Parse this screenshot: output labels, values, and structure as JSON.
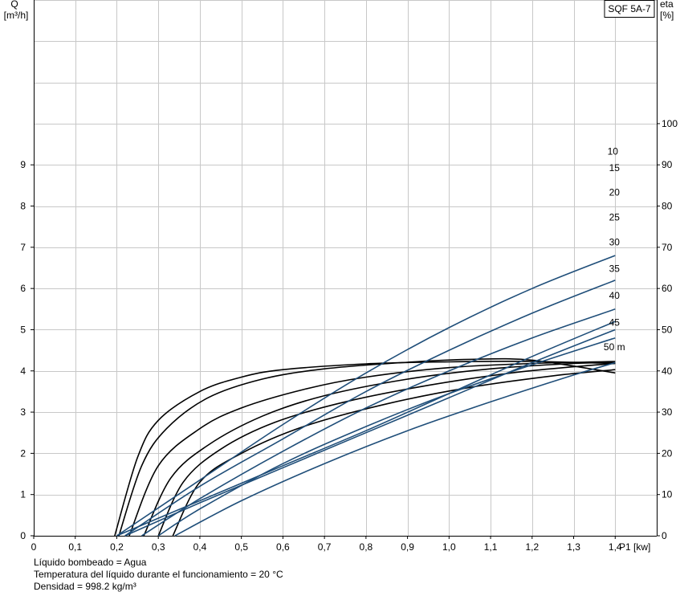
{
  "chart_data": {
    "type": "line",
    "title": "SQF 5A-7",
    "x_axis": {
      "label": "P1 [kw]",
      "min": 0,
      "max": 1.5,
      "ticks": [
        0,
        0.1,
        0.2,
        0.3,
        0.4,
        0.5,
        0.6,
        0.7,
        0.8,
        0.9,
        1.0,
        1.1,
        1.2,
        1.3,
        1.4
      ],
      "tick_labels": [
        "0",
        "0,1",
        "0,2",
        "0,3",
        "0,4",
        "0,5",
        "0,6",
        "0,7",
        "0,8",
        "0,9",
        "1,0",
        "1,1",
        "1,2",
        "1,3",
        "1,4"
      ]
    },
    "y_left": {
      "label_line1": "Q",
      "label_line2": "[m³/h]",
      "min": 0,
      "max": 13,
      "ticks": [
        0,
        1,
        2,
        3,
        4,
        5,
        6,
        7,
        8,
        9
      ],
      "tick_labels": [
        "0",
        "1",
        "2",
        "3",
        "4",
        "5",
        "6",
        "7",
        "8",
        "9"
      ]
    },
    "y_right": {
      "label_line1": "eta",
      "label_line2": "[%]",
      "min": 0,
      "max": 130,
      "ticks": [
        0,
        10,
        20,
        30,
        40,
        50,
        60,
        70,
        80,
        90,
        100
      ],
      "tick_labels": [
        "0",
        "10",
        "20",
        "30",
        "40",
        "50",
        "60",
        "70",
        "80",
        "90",
        "100"
      ]
    },
    "grid": true,
    "flow_series": [
      {
        "name": "10",
        "points": [
          [
            0.2,
            0
          ],
          [
            0.4,
            0.85
          ],
          [
            0.6,
            1.7
          ],
          [
            0.8,
            2.55
          ],
          [
            1.0,
            3.45
          ],
          [
            1.2,
            4.35
          ],
          [
            1.4,
            5.2
          ]
        ]
      },
      {
        "name": "15",
        "points": [
          [
            0.22,
            0
          ],
          [
            0.4,
            0.8
          ],
          [
            0.6,
            1.65
          ],
          [
            0.8,
            2.5
          ],
          [
            1.0,
            3.35
          ],
          [
            1.2,
            4.2
          ],
          [
            1.4,
            5.0
          ]
        ]
      },
      {
        "name": "20",
        "points": [
          [
            0.2,
            0
          ],
          [
            0.4,
            1.35
          ],
          [
            0.6,
            2.7
          ],
          [
            0.8,
            3.95
          ],
          [
            1.0,
            5.05
          ],
          [
            1.2,
            6.0
          ],
          [
            1.4,
            6.8
          ]
        ]
      },
      {
        "name": "25",
        "points": [
          [
            0.22,
            0
          ],
          [
            0.4,
            1.2
          ],
          [
            0.6,
            2.35
          ],
          [
            0.8,
            3.5
          ],
          [
            1.0,
            4.5
          ],
          [
            1.2,
            5.4
          ],
          [
            1.4,
            6.2
          ]
        ]
      },
      {
        "name": "30",
        "points": [
          [
            0.26,
            0
          ],
          [
            0.4,
            0.9
          ],
          [
            0.6,
            2.05
          ],
          [
            0.8,
            3.1
          ],
          [
            1.0,
            4.0
          ],
          [
            1.2,
            4.8
          ],
          [
            1.4,
            5.5
          ]
        ]
      },
      {
        "name": "35",
        "points": [
          [
            0.3,
            0
          ],
          [
            0.4,
            0.65
          ],
          [
            0.6,
            1.75
          ],
          [
            0.8,
            2.65
          ],
          [
            1.0,
            3.45
          ],
          [
            1.2,
            4.15
          ],
          [
            1.4,
            4.8
          ]
        ]
      },
      {
        "name": "40",
        "points": [
          [
            0.34,
            0
          ],
          [
            0.5,
            0.85
          ],
          [
            0.7,
            1.75
          ],
          [
            0.9,
            2.55
          ],
          [
            1.1,
            3.25
          ],
          [
            1.3,
            3.9
          ],
          [
            1.4,
            4.2
          ]
        ]
      }
    ],
    "efficiency_series": [
      {
        "points": [
          [
            0.195,
            0
          ],
          [
            0.25,
            19
          ],
          [
            0.3,
            28
          ],
          [
            0.4,
            35
          ],
          [
            0.5,
            38.5
          ],
          [
            0.6,
            40.3
          ],
          [
            0.8,
            41.7
          ],
          [
            1.0,
            42.2
          ],
          [
            1.2,
            42.3
          ],
          [
            1.4,
            41.8
          ]
        ]
      },
      {
        "points": [
          [
            0.205,
            0
          ],
          [
            0.26,
            17
          ],
          [
            0.32,
            26
          ],
          [
            0.42,
            33.5
          ],
          [
            0.55,
            38
          ],
          [
            0.7,
            40.5
          ],
          [
            0.9,
            42.1
          ],
          [
            1.05,
            42.8
          ],
          [
            1.2,
            42.6
          ],
          [
            1.4,
            39.5
          ]
        ]
      },
      {
        "points": [
          [
            0.23,
            0
          ],
          [
            0.3,
            17
          ],
          [
            0.4,
            26
          ],
          [
            0.5,
            31
          ],
          [
            0.65,
            35.5
          ],
          [
            0.8,
            38.5
          ],
          [
            1.0,
            40.8
          ],
          [
            1.2,
            41.8
          ],
          [
            1.4,
            42.3
          ]
        ]
      },
      {
        "points": [
          [
            0.265,
            0
          ],
          [
            0.33,
            14
          ],
          [
            0.42,
            22
          ],
          [
            0.55,
            29
          ],
          [
            0.7,
            34
          ],
          [
            0.9,
            38
          ],
          [
            1.1,
            40.5
          ],
          [
            1.3,
            41.8
          ],
          [
            1.4,
            42.0
          ]
        ]
      },
      {
        "points": [
          [
            0.3,
            0
          ],
          [
            0.36,
            13
          ],
          [
            0.45,
            21
          ],
          [
            0.58,
            27.5
          ],
          [
            0.75,
            32.5
          ],
          [
            0.95,
            36.5
          ],
          [
            1.15,
            39.5
          ],
          [
            1.3,
            41
          ],
          [
            1.4,
            41.8
          ]
        ]
      },
      {
        "points": [
          [
            0.335,
            0
          ],
          [
            0.4,
            13
          ],
          [
            0.5,
            20
          ],
          [
            0.65,
            26.5
          ],
          [
            0.85,
            32
          ],
          [
            1.05,
            36
          ],
          [
            1.25,
            38.8
          ],
          [
            1.4,
            40.3
          ]
        ]
      }
    ],
    "head_labels": [
      {
        "text": "10",
        "y_level": 9.25
      },
      {
        "text": "15",
        "y_level": 8.85
      },
      {
        "text": "20",
        "y_level": 8.25
      },
      {
        "text": "25",
        "y_level": 7.65
      },
      {
        "text": "30",
        "y_level": 7.05
      },
      {
        "text": "35",
        "y_level": 6.4
      },
      {
        "text": "40",
        "y_level": 5.75
      },
      {
        "text": "45",
        "y_level": 5.1
      },
      {
        "text": "50 m",
        "y_level": 4.5
      }
    ]
  },
  "notes": {
    "line1": "Líquido bombeado = Agua",
    "line2": "Temperatura del líquido durante el funcionamiento = 20 °C",
    "line3": "Densidad = 998.2 kg/m³"
  },
  "colors": {
    "flow_curve": "#1f4e79",
    "efficiency_curve": "#000000",
    "grid": "#c8c8c8",
    "axis": "#000000"
  }
}
